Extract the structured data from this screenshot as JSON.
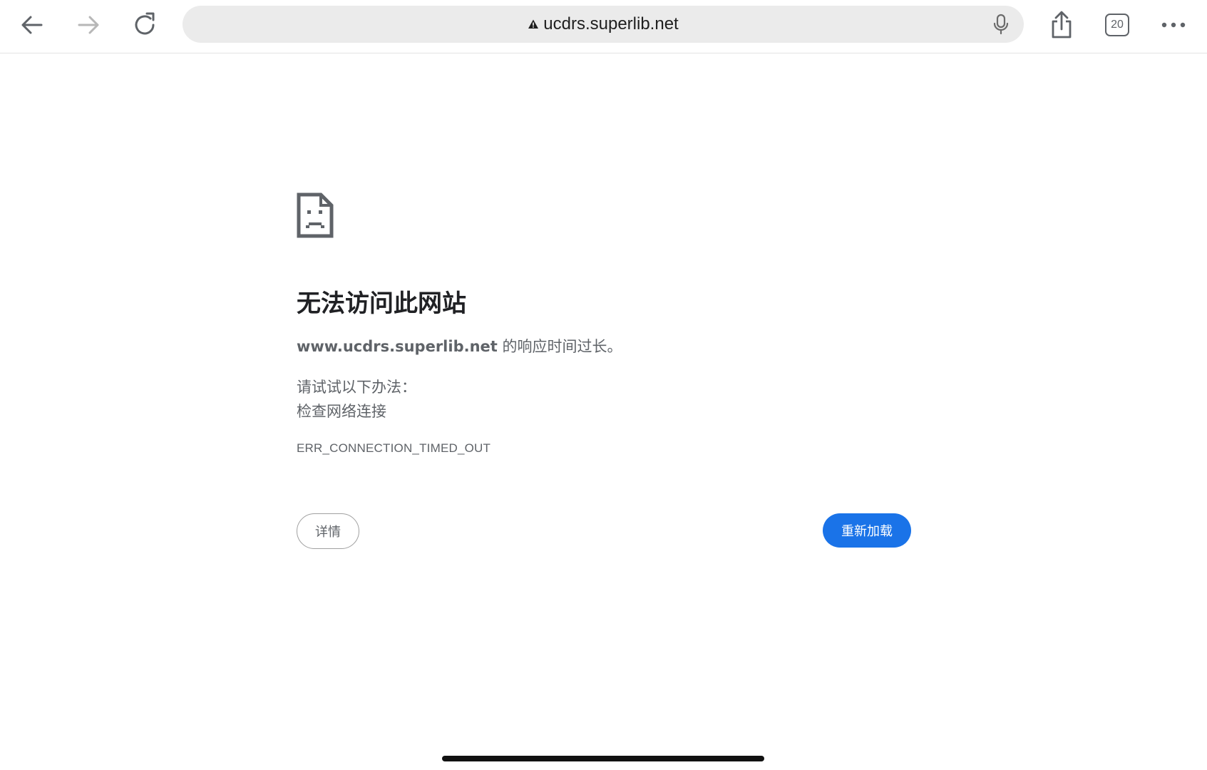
{
  "browser": {
    "address": "ucdrs.superlib.net",
    "tab_count": "20"
  },
  "icons": {
    "back": "arrow-left-icon",
    "forward": "arrow-right-icon",
    "reload": "reload-icon",
    "security": "warning-triangle-icon",
    "mic": "microphone-icon",
    "share": "share-icon",
    "tabs": "tab-switcher-icon",
    "menu": "more-horizontal-icon",
    "error": "sad-document-icon"
  },
  "error_page": {
    "title": "无法访问此网站",
    "host": "www.ucdrs.superlib.net",
    "description_suffix": " 的响应时间过长。",
    "try_heading": "请试试以下办法：",
    "suggestion": "检查网络连接",
    "error_code": "ERR_CONNECTION_TIMED_OUT",
    "details_label": "详情",
    "reload_label": "重新加载"
  },
  "colors": {
    "accent": "#1a73e8",
    "text_secondary": "#5f6368",
    "omnibox_bg": "#ebebeb"
  }
}
